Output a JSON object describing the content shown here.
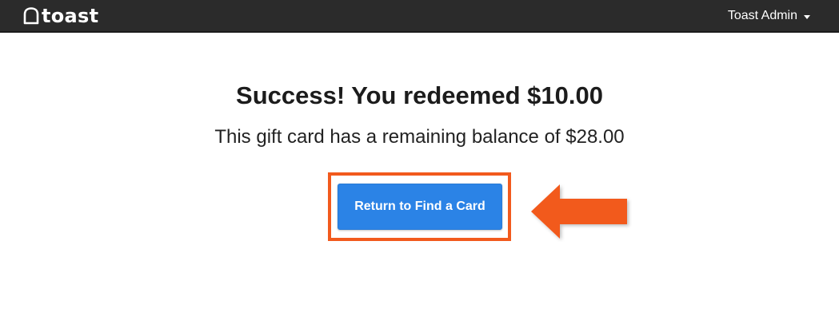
{
  "header": {
    "logo_text": "toast",
    "user_label": "Toast Admin"
  },
  "main": {
    "headline": "Success! You redeemed $10.00",
    "subline": "This gift card has a remaining balance of $28.00",
    "return_button_label": "Return to Find a Card"
  },
  "icons": {
    "logo": "toast-logo-icon",
    "user_menu_caret": "caret-down-icon",
    "annotation": "left-arrow-icon"
  },
  "colors": {
    "header_bg": "#2b2b2b",
    "button_bg": "#2b83e6",
    "annotation_orange": "#f25a1d"
  }
}
